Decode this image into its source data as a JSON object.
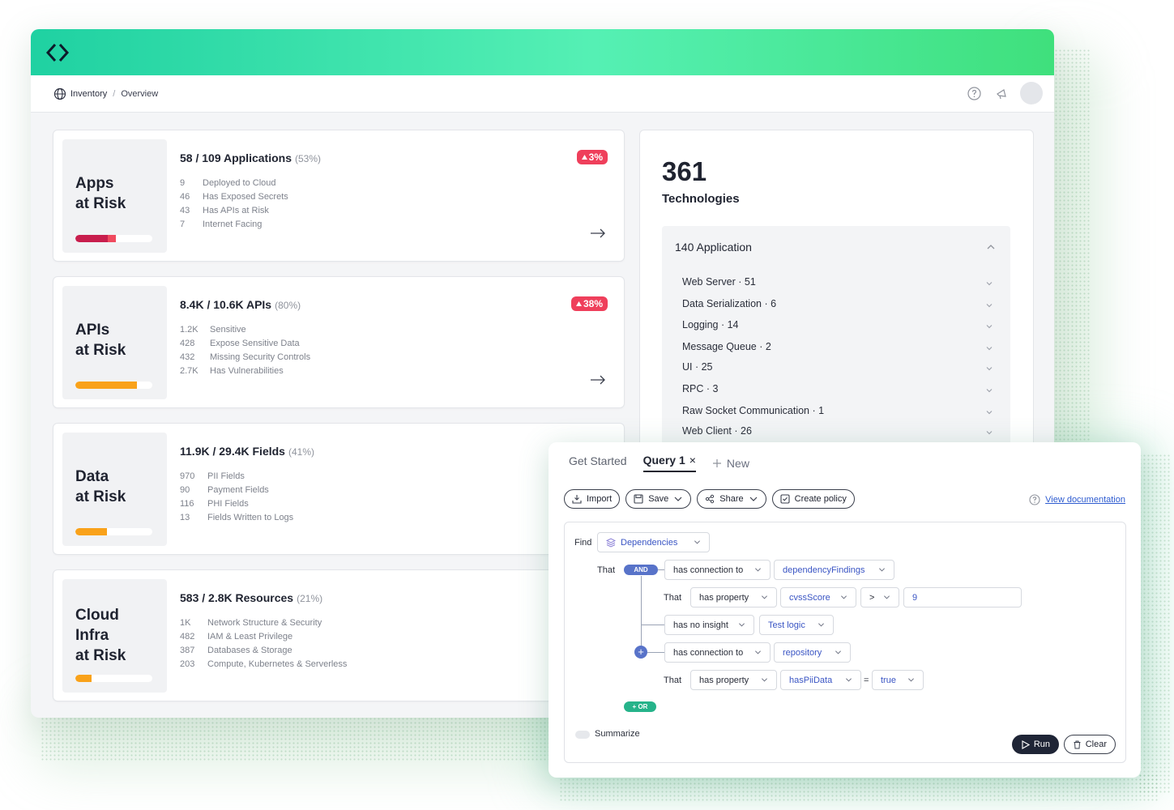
{
  "breadcrumb": {
    "root": "Inventory",
    "separator": "/",
    "current": "Overview"
  },
  "header_icons": [
    "help-icon",
    "megaphone-icon",
    "avatar"
  ],
  "cards": [
    {
      "title": "Apps\nat Risk",
      "headline": "58 / 109 Applications",
      "percent": "(53%)",
      "badge": "3%",
      "bar_fraction": 0.53,
      "bar_color": "#d6234f",
      "stats": [
        {
          "n": "9",
          "label": "Deployed to Cloud"
        },
        {
          "n": "46",
          "label": "Has Exposed Secrets"
        },
        {
          "n": "43",
          "label": "Has APIs at Risk"
        },
        {
          "n": "7",
          "label": "Internet Facing"
        }
      ]
    },
    {
      "title": "APIs\nat Risk",
      "headline": "8.4K / 10.6K APIs",
      "percent": "(80%)",
      "badge": "38%",
      "bar_fraction": 0.8,
      "bar_color": "#f9a21a",
      "stats": [
        {
          "n": "1.2K",
          "label": "Sensitive"
        },
        {
          "n": "428",
          "label": "Expose Sensitive Data"
        },
        {
          "n": "432",
          "label": "Missing Security Controls"
        },
        {
          "n": "2.7K",
          "label": "Has Vulnerabilities"
        }
      ]
    },
    {
      "title": "Data\nat Risk",
      "headline": "11.9K / 29.4K Fields",
      "percent": "(41%)",
      "badge": "",
      "bar_fraction": 0.41,
      "bar_color": "#f9a21a",
      "stats": [
        {
          "n": "970",
          "label": "PII Fields"
        },
        {
          "n": "90",
          "label": "Payment Fields"
        },
        {
          "n": "116",
          "label": "PHI Fields"
        },
        {
          "n": "13",
          "label": "Fields Written to Logs"
        }
      ]
    },
    {
      "title": "Cloud\nInfra\nat Risk",
      "headline": "583 / 2.8K Resources",
      "percent": "(21%)",
      "badge": "",
      "bar_fraction": 0.21,
      "bar_color": "#f9a21a",
      "stats": [
        {
          "n": "1K",
          "label": "Network Structure & Security"
        },
        {
          "n": "482",
          "label": "IAM & Least Privilege"
        },
        {
          "n": "387",
          "label": "Databases & Storage"
        },
        {
          "n": "203",
          "label": "Compute, Kubernetes & Serverless"
        }
      ]
    }
  ],
  "technologies": {
    "count": "361",
    "label": "Technologies",
    "group_title": "140 Application",
    "items": [
      "Web Server · 51",
      "Data Serialization · 6",
      "Logging · 14",
      "Message Queue · 2",
      "UI · 25",
      "RPC · 3",
      "Raw Socket Communication · 1",
      "Web Client · 26"
    ]
  },
  "query": {
    "tabs": {
      "get_started": "Get Started",
      "active": "Query 1",
      "close": "×",
      "new": "New"
    },
    "toolbar": {
      "import": "Import",
      "save": "Save",
      "share": "Share",
      "create_policy": "Create policy"
    },
    "doc_link": "View documentation",
    "find_label": "Find",
    "find_value": "Dependencies",
    "that_label": "That",
    "and_pill": "AND",
    "or_pill": "+ OR",
    "rows": {
      "r1_rel": "has connection to",
      "r1_target": "dependencyFindings",
      "r2_prop": "has property",
      "r2_field": "cvssScore",
      "r2_op": ">",
      "r2_value": "9",
      "r3_rel": "has no insight",
      "r3_target": "Test logic",
      "r4_rel": "has connection to",
      "r4_target": "repository",
      "r5_prop": "has property",
      "r5_field": "hasPiiData",
      "r5_eq": "=",
      "r5_value": "true"
    },
    "summarize": "Summarize",
    "run": "Run",
    "clear": "Clear"
  },
  "colors": {
    "accent_green": "#3fe07c",
    "badge_red": "#ef3f5b",
    "link_blue": "#2d5bd0",
    "and_blue": "#5873c9",
    "or_green": "#26b38a"
  }
}
